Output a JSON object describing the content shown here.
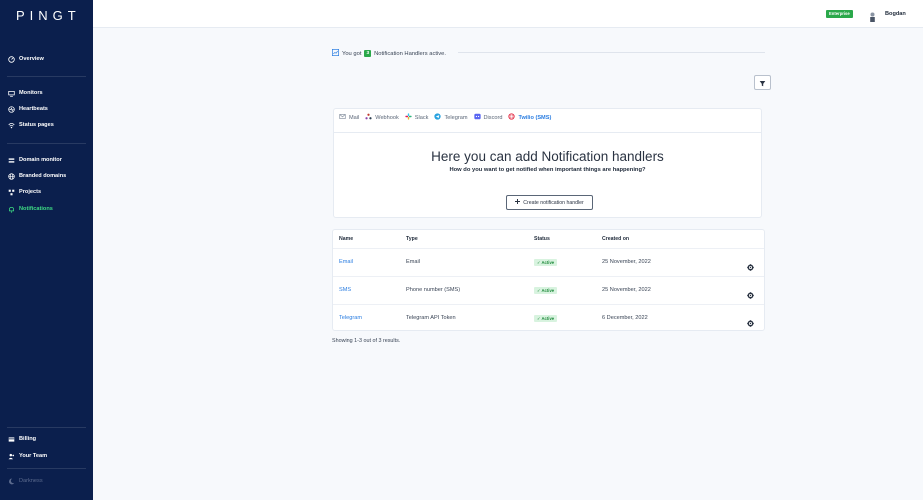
{
  "app": {
    "logo": "PINGT"
  },
  "sidebar": {
    "items": [
      {
        "label": "Overview",
        "icon": "gauge-icon"
      },
      {
        "label": "Monitors",
        "icon": "monitor-icon"
      },
      {
        "label": "Heartbeats",
        "icon": "heartbeat-icon"
      },
      {
        "label": "Status pages",
        "icon": "wifi-icon"
      },
      {
        "label": "Domain monitor",
        "icon": "domain-icon"
      },
      {
        "label": "Branded domains",
        "icon": "globe-icon"
      },
      {
        "label": "Projects",
        "icon": "projects-icon"
      },
      {
        "label": "Notifications",
        "icon": "bell-icon"
      },
      {
        "label": "Billing",
        "icon": "card-icon"
      },
      {
        "label": "Your Team",
        "icon": "team-icon"
      },
      {
        "label": "Darkness",
        "icon": "moon-icon"
      }
    ],
    "active_label": "Notifications"
  },
  "topbar": {
    "plan_badge": "Enterprise",
    "user_name": "Bogdan"
  },
  "summary": {
    "prefix": "You got",
    "count": "3",
    "suffix": "Notification Handlers active."
  },
  "card": {
    "tabs": [
      {
        "label": "Mail",
        "icon": "mail-icon"
      },
      {
        "label": "Webhook",
        "icon": "webhook-icon"
      },
      {
        "label": "Slack",
        "icon": "slack-icon"
      },
      {
        "label": "Telegram",
        "icon": "telegram-icon"
      },
      {
        "label": "Discord",
        "icon": "discord-icon"
      },
      {
        "label": "Twilio (SMS)",
        "icon": "twilio-icon"
      }
    ],
    "active_tab": "Twilio (SMS)",
    "title": "Here you can add Notification handlers",
    "subtitle": "How do you want to get notified when important things are happening?",
    "create_label": "Create notification handler"
  },
  "table": {
    "headers": {
      "name": "Name",
      "type": "Type",
      "status": "Status",
      "created": "Created on"
    },
    "rows": [
      {
        "name": "Email",
        "type": "Email",
        "status": "Active",
        "created": "25 November, 2022"
      },
      {
        "name": "SMS",
        "type": "Phone number (SMS)",
        "status": "Active",
        "created": "25 November, 2022"
      },
      {
        "name": "Telegram",
        "type": "Telegram API Token",
        "status": "Active",
        "created": "6 December, 2022"
      }
    ]
  },
  "footer": {
    "showing": "Showing 1-3 out of 3 results."
  },
  "colors": {
    "sidebar_bg": "#0b1f4d",
    "accent_green": "#3ddc84",
    "link_blue": "#2a7de1",
    "badge_green": "#2aa84a"
  }
}
